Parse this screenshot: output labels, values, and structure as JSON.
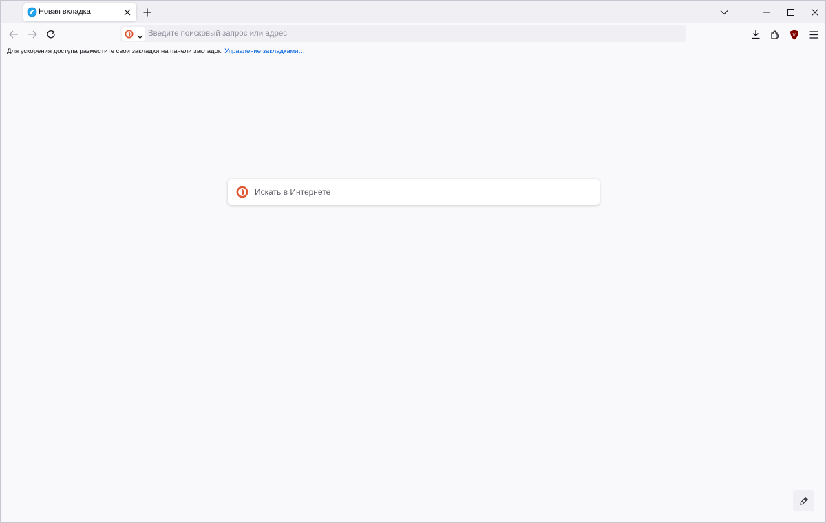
{
  "tab": {
    "title": "Новая вкладка",
    "favicon": "firefox-icon"
  },
  "navbar": {
    "url_placeholder": "Введите поисковый запрос или адрес",
    "search_engine_icon": "duckduckgo-icon"
  },
  "bookmarks_bar": {
    "message": "Для ускорения доступа разместите свои закладки на панели закладок.",
    "manage_link": "Управление закладками…"
  },
  "content": {
    "search_placeholder": "Искать в Интернете",
    "search_engine_icon": "duckduckgo-icon"
  },
  "colors": {
    "tabstrip_bg": "#f0f0f4",
    "content_bg": "#f9f9fb",
    "link": "#0061e0",
    "ublock_red": "#800000"
  }
}
